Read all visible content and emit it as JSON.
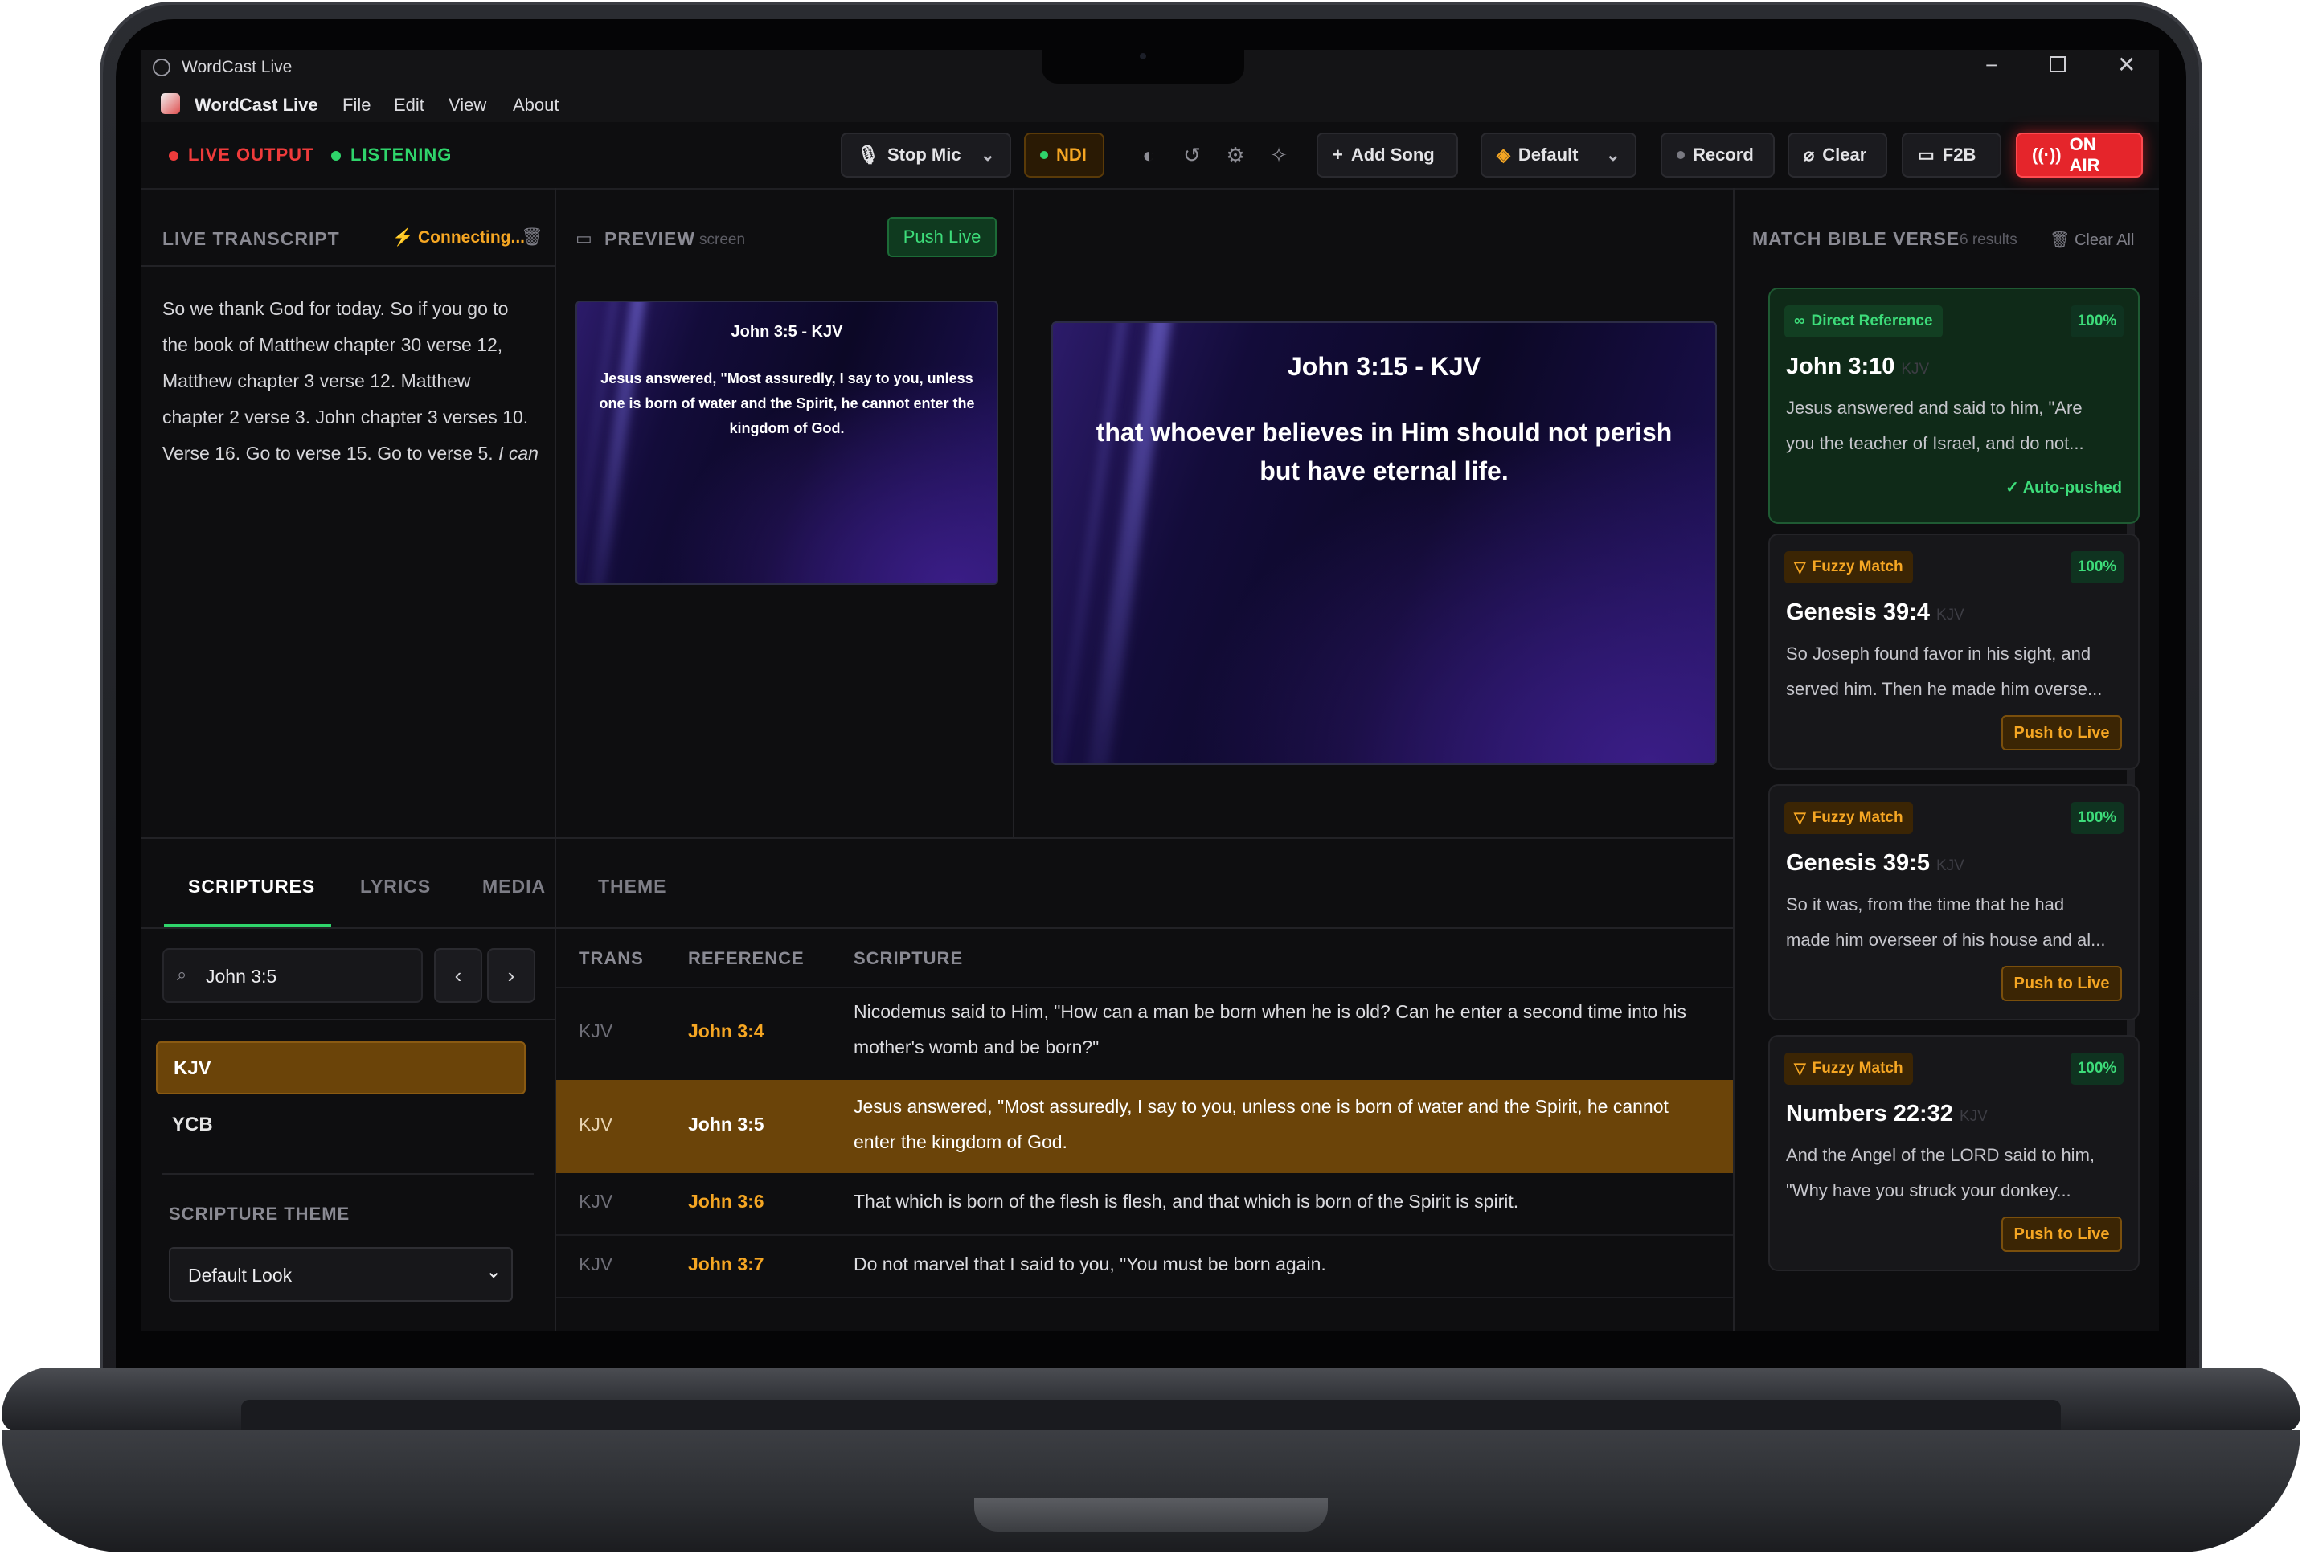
{
  "window": {
    "title": "WordCast Live"
  },
  "menu": {
    "app_name": "WordCast Live",
    "items": [
      "File",
      "Edit",
      "View",
      "About"
    ]
  },
  "status": {
    "live_output": "LIVE OUTPUT",
    "listening": "LISTENING"
  },
  "toolbar": {
    "stop_mic": "Stop Mic",
    "ndi": "NDI",
    "add_song": "Add Song",
    "theme_select": "Default",
    "record": "Record",
    "clear": "Clear",
    "f2b": "F2B",
    "on_air": "ON AIR"
  },
  "transcript": {
    "header": "LIVE TRANSCRIPT",
    "status": "Connecting...",
    "lines": [
      "So we thank God for today. So if you go to",
      "the book of Matthew chapter 30 verse 12,",
      "Matthew chapter 3 verse 12. Matthew",
      "chapter 2 verse 3. John chapter 3 verses 10.",
      "Verse 16. Go to verse 15. Go to verse 5."
    ],
    "partial": "I can"
  },
  "preview": {
    "header": "PREVIEW",
    "sub": "screen",
    "push_live": "Push Live",
    "slide_title": "John 3:5 - KJV",
    "slide_text": "Jesus answered, \"Most assuredly, I say to you, unless one is born of water and the Spirit, he cannot enter the kingdom of God."
  },
  "live": {
    "slide_title": "John 3:15 - KJV",
    "slide_text": "that whoever believes in Him should not perish but have eternal life."
  },
  "tabs": [
    "SCRIPTURES",
    "LYRICS",
    "MEDIA",
    "THEME"
  ],
  "search": {
    "value": "John 3:5"
  },
  "translations": [
    "KJV",
    "YCB"
  ],
  "scripture_theme": {
    "label": "SCRIPTURE THEME",
    "value": "Default Look"
  },
  "table": {
    "headers": [
      "TRANS",
      "REFERENCE",
      "SCRIPTURE"
    ],
    "rows": [
      {
        "trans": "KJV",
        "ref": "John 3:4",
        "text1": "Nicodemus said to Him, \"How can a man be born when he is old? Can he enter a second time into his",
        "text2": "mother's womb and be born?\""
      },
      {
        "trans": "KJV",
        "ref": "John 3:5",
        "text1": "Jesus answered, \"Most assuredly, I say to you, unless one is born of water and the Spirit, he cannot",
        "text2": "enter the kingdom of God."
      },
      {
        "trans": "KJV",
        "ref": "John 3:6",
        "text1": "That which is born of the flesh is flesh, and that which is born of the Spirit is spirit.",
        "text2": ""
      },
      {
        "trans": "KJV",
        "ref": "John 3:7",
        "text1": "Do not marvel that I said to you, \"You must be born again.",
        "text2": ""
      }
    ]
  },
  "matches": {
    "header": "MATCH BIBLE VERSE",
    "count": "6 results",
    "clear_all": "Clear All",
    "cards": [
      {
        "badge": "Direct Reference",
        "pct": "100%",
        "ref": "John 3:10",
        "version": "KJV",
        "line1": "Jesus answered and said to him, \"Are",
        "line2": "you the teacher of Israel, and do not...",
        "footer": "Auto-pushed"
      },
      {
        "badge": "Fuzzy Match",
        "pct": "100%",
        "ref": "Genesis 39:4",
        "version": "KJV",
        "line1": "So Joseph found favor in his sight, and",
        "line2": "served him. Then he made him overse...",
        "footer": "Push to Live"
      },
      {
        "badge": "Fuzzy Match",
        "pct": "100%",
        "ref": "Genesis 39:5",
        "version": "KJV",
        "line1": "So it was, from the time that he had",
        "line2": "made him overseer of his house and al...",
        "footer": "Push to Live"
      },
      {
        "badge": "Fuzzy Match",
        "pct": "100%",
        "ref": "Numbers 22:32",
        "version": "KJV",
        "line1": "And the Angel of the LORD said to him,",
        "line2": "\"Why have you struck your donkey...",
        "footer": "Push to Live"
      }
    ]
  },
  "colors": {
    "live_red": "#ef3b3b",
    "listening_green": "#2fd46b",
    "accent_orange": "#f5a623",
    "selection_amber": "#6b4409",
    "on_air_red": "#e5252b"
  }
}
